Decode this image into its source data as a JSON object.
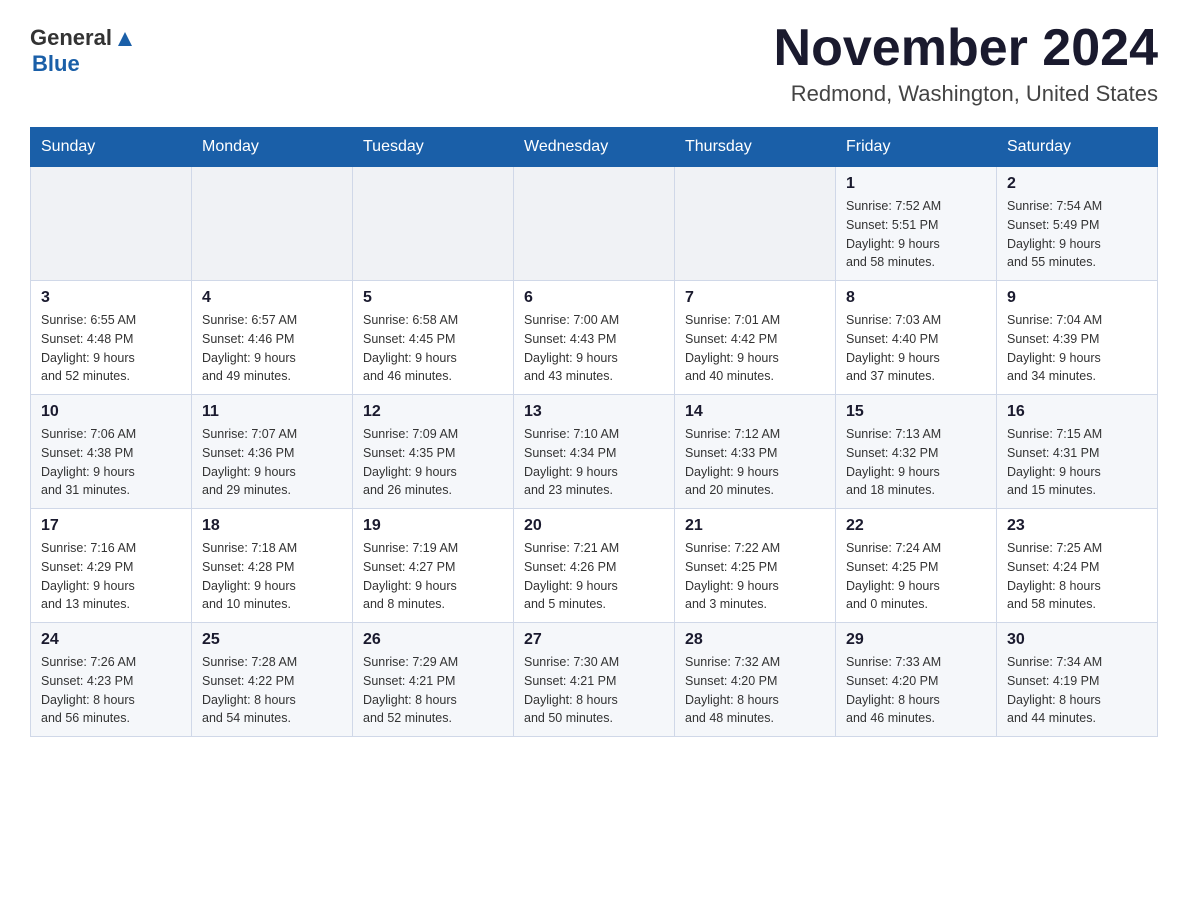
{
  "header": {
    "logo_general": "General",
    "logo_blue": "Blue",
    "title": "November 2024",
    "subtitle": "Redmond, Washington, United States"
  },
  "days_of_week": [
    "Sunday",
    "Monday",
    "Tuesday",
    "Wednesday",
    "Thursday",
    "Friday",
    "Saturday"
  ],
  "weeks": [
    {
      "days": [
        {
          "num": "",
          "info": ""
        },
        {
          "num": "",
          "info": ""
        },
        {
          "num": "",
          "info": ""
        },
        {
          "num": "",
          "info": ""
        },
        {
          "num": "",
          "info": ""
        },
        {
          "num": "1",
          "info": "Sunrise: 7:52 AM\nSunset: 5:51 PM\nDaylight: 9 hours\nand 58 minutes."
        },
        {
          "num": "2",
          "info": "Sunrise: 7:54 AM\nSunset: 5:49 PM\nDaylight: 9 hours\nand 55 minutes."
        }
      ]
    },
    {
      "days": [
        {
          "num": "3",
          "info": "Sunrise: 6:55 AM\nSunset: 4:48 PM\nDaylight: 9 hours\nand 52 minutes."
        },
        {
          "num": "4",
          "info": "Sunrise: 6:57 AM\nSunset: 4:46 PM\nDaylight: 9 hours\nand 49 minutes."
        },
        {
          "num": "5",
          "info": "Sunrise: 6:58 AM\nSunset: 4:45 PM\nDaylight: 9 hours\nand 46 minutes."
        },
        {
          "num": "6",
          "info": "Sunrise: 7:00 AM\nSunset: 4:43 PM\nDaylight: 9 hours\nand 43 minutes."
        },
        {
          "num": "7",
          "info": "Sunrise: 7:01 AM\nSunset: 4:42 PM\nDaylight: 9 hours\nand 40 minutes."
        },
        {
          "num": "8",
          "info": "Sunrise: 7:03 AM\nSunset: 4:40 PM\nDaylight: 9 hours\nand 37 minutes."
        },
        {
          "num": "9",
          "info": "Sunrise: 7:04 AM\nSunset: 4:39 PM\nDaylight: 9 hours\nand 34 minutes."
        }
      ]
    },
    {
      "days": [
        {
          "num": "10",
          "info": "Sunrise: 7:06 AM\nSunset: 4:38 PM\nDaylight: 9 hours\nand 31 minutes."
        },
        {
          "num": "11",
          "info": "Sunrise: 7:07 AM\nSunset: 4:36 PM\nDaylight: 9 hours\nand 29 minutes."
        },
        {
          "num": "12",
          "info": "Sunrise: 7:09 AM\nSunset: 4:35 PM\nDaylight: 9 hours\nand 26 minutes."
        },
        {
          "num": "13",
          "info": "Sunrise: 7:10 AM\nSunset: 4:34 PM\nDaylight: 9 hours\nand 23 minutes."
        },
        {
          "num": "14",
          "info": "Sunrise: 7:12 AM\nSunset: 4:33 PM\nDaylight: 9 hours\nand 20 minutes."
        },
        {
          "num": "15",
          "info": "Sunrise: 7:13 AM\nSunset: 4:32 PM\nDaylight: 9 hours\nand 18 minutes."
        },
        {
          "num": "16",
          "info": "Sunrise: 7:15 AM\nSunset: 4:31 PM\nDaylight: 9 hours\nand 15 minutes."
        }
      ]
    },
    {
      "days": [
        {
          "num": "17",
          "info": "Sunrise: 7:16 AM\nSunset: 4:29 PM\nDaylight: 9 hours\nand 13 minutes."
        },
        {
          "num": "18",
          "info": "Sunrise: 7:18 AM\nSunset: 4:28 PM\nDaylight: 9 hours\nand 10 minutes."
        },
        {
          "num": "19",
          "info": "Sunrise: 7:19 AM\nSunset: 4:27 PM\nDaylight: 9 hours\nand 8 minutes."
        },
        {
          "num": "20",
          "info": "Sunrise: 7:21 AM\nSunset: 4:26 PM\nDaylight: 9 hours\nand 5 minutes."
        },
        {
          "num": "21",
          "info": "Sunrise: 7:22 AM\nSunset: 4:25 PM\nDaylight: 9 hours\nand 3 minutes."
        },
        {
          "num": "22",
          "info": "Sunrise: 7:24 AM\nSunset: 4:25 PM\nDaylight: 9 hours\nand 0 minutes."
        },
        {
          "num": "23",
          "info": "Sunrise: 7:25 AM\nSunset: 4:24 PM\nDaylight: 8 hours\nand 58 minutes."
        }
      ]
    },
    {
      "days": [
        {
          "num": "24",
          "info": "Sunrise: 7:26 AM\nSunset: 4:23 PM\nDaylight: 8 hours\nand 56 minutes."
        },
        {
          "num": "25",
          "info": "Sunrise: 7:28 AM\nSunset: 4:22 PM\nDaylight: 8 hours\nand 54 minutes."
        },
        {
          "num": "26",
          "info": "Sunrise: 7:29 AM\nSunset: 4:21 PM\nDaylight: 8 hours\nand 52 minutes."
        },
        {
          "num": "27",
          "info": "Sunrise: 7:30 AM\nSunset: 4:21 PM\nDaylight: 8 hours\nand 50 minutes."
        },
        {
          "num": "28",
          "info": "Sunrise: 7:32 AM\nSunset: 4:20 PM\nDaylight: 8 hours\nand 48 minutes."
        },
        {
          "num": "29",
          "info": "Sunrise: 7:33 AM\nSunset: 4:20 PM\nDaylight: 8 hours\nand 46 minutes."
        },
        {
          "num": "30",
          "info": "Sunrise: 7:34 AM\nSunset: 4:19 PM\nDaylight: 8 hours\nand 44 minutes."
        }
      ]
    }
  ]
}
